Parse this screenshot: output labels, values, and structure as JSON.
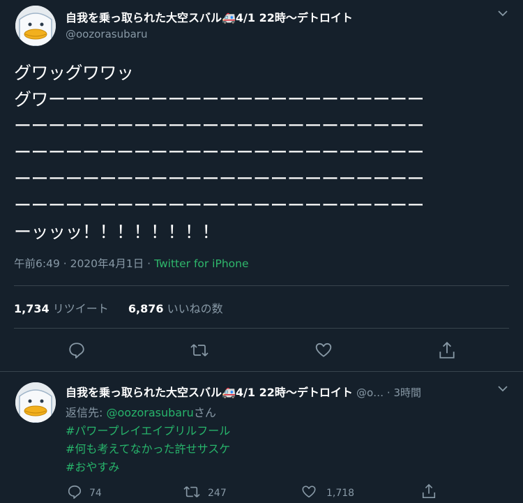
{
  "main_tweet": {
    "display_name": "自我を乗っ取られた大空スバル🚑4/1 22時〜デトロイト",
    "handle": "@oozorasubaru",
    "lines": [
      "グワッグワワッ",
      "グワーーーーーーーーーーーーーーーーーーーーーー",
      "ーーーーーーーーーーーーーーーーーーーーーーーー",
      "ーーーーーーーーーーーーーーーーーーーーーーーー",
      "ーーーーーーーーーーーーーーーーーーーーーーーー",
      "ーーーーーーーーーーーーーーーーーーーーーーーー",
      "ーッッッ！！！！！！！！"
    ],
    "timestamp": "午前6:49 · 2020年4月1日 ·",
    "source": "Twitter for iPhone",
    "retweets_count": "1,734",
    "retweets_label": "リツイート",
    "likes_count": "6,876",
    "likes_label": "いいねの数"
  },
  "reply_tweet": {
    "display_name": "自我を乗っ取られた大空スバル🚑4/1 22時〜デトロイト",
    "handle_time": "@o… · 3時間",
    "reply_prefix": "返信先:",
    "reply_mention": "@oozorasubaru",
    "reply_suffix": "さん",
    "hashtags": [
      "#パワープレイエイプリルフール",
      "#何も考えてなかった許せサスケ",
      "#おやすみ"
    ],
    "reply_count": "74",
    "retweet_count": "247",
    "like_count": "1,718"
  },
  "colors": {
    "background": "#15202b",
    "divider": "#38444d",
    "secondary_text": "#8899a6",
    "link_green": "#27b46b"
  }
}
